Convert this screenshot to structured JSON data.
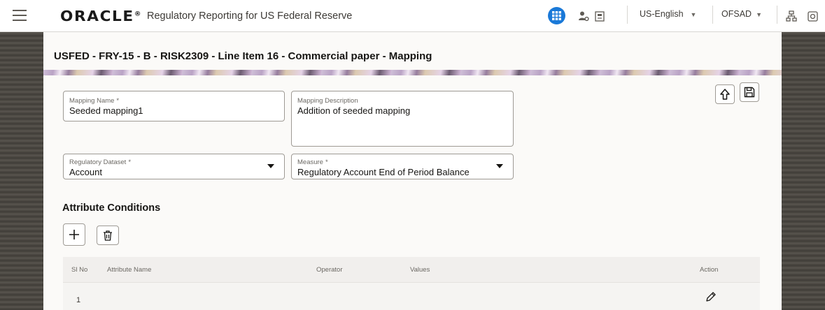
{
  "header": {
    "logo": "ORACLE",
    "logo_mark": "®",
    "app_title": "Regulatory Reporting for US Federal Reserve",
    "language": "US-English",
    "user": "OFSAD"
  },
  "page": {
    "title": "USFED - FRY-15 - B - RISK2309 - Line Item 16 - Commercial paper - Mapping"
  },
  "form": {
    "mapping_name": {
      "label": "Mapping Name",
      "required": "*",
      "value": "Seeded mapping1"
    },
    "mapping_description": {
      "label": "Mapping Description",
      "value": "Addition of seeded mapping"
    },
    "regulatory_dataset": {
      "label": "Regulatory Dataset",
      "required": "*",
      "value": "Account"
    },
    "measure": {
      "label": "Measure",
      "required": "*",
      "value": "Regulatory Account End of Period Balance"
    }
  },
  "attribute_conditions": {
    "title": "Attribute Conditions",
    "columns": [
      "Sl No",
      "Attribute Name",
      "Operator",
      "Values",
      "Action"
    ],
    "rows": [
      {
        "sl_no": "1",
        "attribute_name": "",
        "operator": "",
        "values": ""
      }
    ]
  },
  "icons": {
    "menu": "hamburger-icon",
    "apps": "grid-icon",
    "user_admin": "user-gear-icon",
    "report": "document-icon",
    "hierarchy": "sitemap-icon",
    "help": "help-icon",
    "upload": "arrow-up-icon",
    "save": "save-icon",
    "add": "plus-icon",
    "delete": "trash-icon",
    "edit": "pencil-icon"
  },
  "colors": {
    "accent": "#1a79d8",
    "card": "#fbfaf8",
    "background": "#4d4a44"
  }
}
